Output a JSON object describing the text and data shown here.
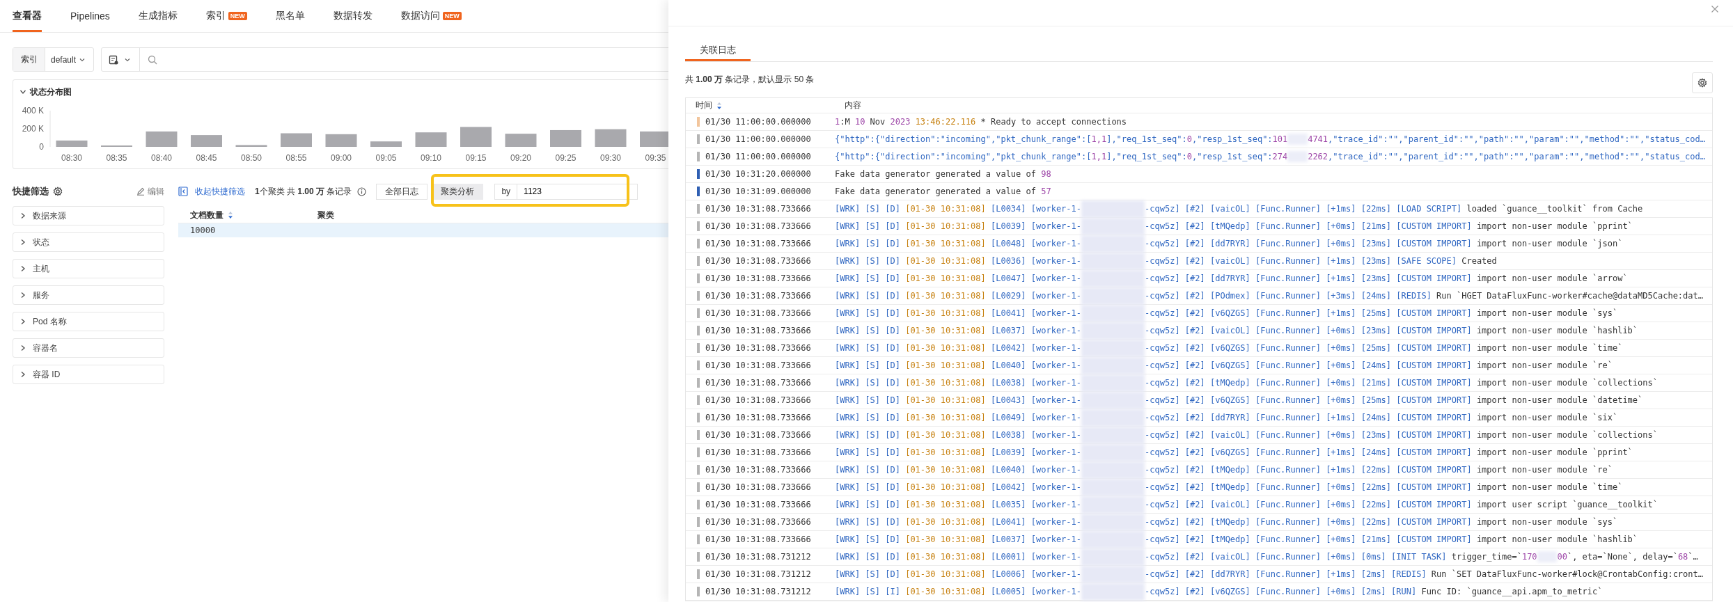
{
  "nav_tabs": [
    {
      "label": "查看器",
      "selected": true
    },
    {
      "label": "Pipelines",
      "selected": false
    },
    {
      "label": "生成指标",
      "selected": false
    },
    {
      "label": "索引",
      "badge": "NEW",
      "selected": false
    },
    {
      "label": "黑名单",
      "selected": false
    },
    {
      "label": "数据转发",
      "selected": false
    },
    {
      "label": "数据访问",
      "badge": "NEW",
      "selected": false
    }
  ],
  "query_bar": {
    "index_label": "索引",
    "index_value": "default"
  },
  "distribution_chart": {
    "title": "状态分布图",
    "expanded": true,
    "chart_data": {
      "type": "bar",
      "categories": [
        "08:30",
        "08:35",
        "08:40",
        "08:45",
        "08:50",
        "08:55",
        "09:00",
        "09:05",
        "09:10",
        "09:15",
        "09:20",
        "09:25",
        "09:30",
        "09:35"
      ],
      "values": [
        70000,
        15000,
        170000,
        130000,
        20000,
        150000,
        140000,
        60000,
        160000,
        220000,
        145000,
        185000,
        195000,
        170000
      ],
      "ylim": [
        0,
        400000
      ],
      "yticks": [
        {
          "value": 0,
          "label": "0"
        },
        {
          "value": 200000,
          "label": "200 K"
        },
        {
          "value": 400000,
          "label": "400 K"
        }
      ]
    }
  },
  "quick_filter": {
    "title": "快捷筛选",
    "edit_label": "编辑",
    "groups": [
      {
        "label": "数据来源",
        "expanded": false
      },
      {
        "label": "状态",
        "expanded": false
      },
      {
        "label": "主机",
        "expanded": false
      },
      {
        "label": "服务",
        "expanded": false
      },
      {
        "label": "Pod 名称",
        "expanded": false
      },
      {
        "label": "容器名",
        "expanded": false
      },
      {
        "label": "容器 ID",
        "expanded": false
      }
    ]
  },
  "cluster_toolbar": {
    "collapse_link": "收起快捷筛选",
    "summary": "**1**个聚类 共 **1.00 万** 条记录",
    "modes": [
      {
        "label": "全部日志",
        "selected": false
      },
      {
        "label": "聚类分析",
        "selected": true
      }
    ],
    "by_label": "by",
    "field_value": "1123",
    "highlighted": true
  },
  "cluster_table": {
    "columns": [
      {
        "label": "文档数量",
        "sortable": true
      },
      {
        "label": "聚类",
        "sortable": false
      }
    ],
    "rows": [
      {
        "count": "10000",
        "selected": true
      }
    ]
  },
  "drawer": {
    "tabs": [
      {
        "label": "关联日志",
        "selected": true
      }
    ],
    "summary": "共 **1.00 万** 条记录，默认显示 50 条",
    "columns": [
      {
        "label": "时间",
        "sortable": true
      },
      {
        "label": "内容",
        "sortable": false
      }
    ],
    "rows": [
      {
        "color": "#f2c59c",
        "time": "01/30 11:00:00.000000",
        "content": [
          {
            "kind": "num",
            "text": "1"
          },
          {
            "kind": "plain",
            "text": ":M "
          },
          {
            "kind": "num",
            "text": "10"
          },
          {
            "kind": "plain",
            "text": " Nov "
          },
          {
            "kind": "num",
            "text": "2023"
          },
          {
            "kind": "stamp",
            "text": " 13:46:22.116"
          },
          {
            "kind": "plain",
            "text": " * Ready to accept connections"
          }
        ]
      },
      {
        "color": "#b5b5b5",
        "time": "01/30 11:00:00.000000",
        "content": [
          {
            "kind": "tag",
            "text": "{\"http\":{\"direction\":\"incoming\",\"pkt_chunk_range\":["
          },
          {
            "kind": "num",
            "text": "1,1"
          },
          {
            "kind": "tag",
            "text": "],\"req_1st_seq\":"
          },
          {
            "kind": "num",
            "text": "0"
          },
          {
            "kind": "tag",
            "text": ",\"resp_1st_seq\":"
          },
          {
            "kind": "num",
            "text": "101"
          },
          {
            "kind": "blur"
          },
          {
            "kind": "num",
            "text": "4741"
          },
          {
            "kind": "tag",
            "text": ",\"trace_id\":\"\",\"parent_id\":\"\",\"path\":\"\",\"param\":\"\",\"method\":\"\",\"status_cod…"
          }
        ]
      },
      {
        "color": "#b5b5b5",
        "time": "01/30 11:00:00.000000",
        "content": [
          {
            "kind": "tag",
            "text": "{\"http\":{\"direction\":\"incoming\",\"pkt_chunk_range\":["
          },
          {
            "kind": "num",
            "text": "1,1"
          },
          {
            "kind": "tag",
            "text": "],\"req_1st_seq\":"
          },
          {
            "kind": "num",
            "text": "0"
          },
          {
            "kind": "tag",
            "text": ",\"resp_1st_seq\":"
          },
          {
            "kind": "num",
            "text": "274"
          },
          {
            "kind": "blur"
          },
          {
            "kind": "num",
            "text": "2262"
          },
          {
            "kind": "tag",
            "text": ",\"trace_id\":\"\",\"parent_id\":\"\",\"path\":\"\",\"param\":\"\",\"method\":\"\",\"status_cod…"
          }
        ]
      },
      {
        "color": "#2f5fb3",
        "time": "01/30 10:31:20.000000",
        "content": [
          {
            "kind": "plain",
            "text": "Fake data generator generated a value of "
          },
          {
            "kind": "num",
            "text": "98"
          }
        ]
      },
      {
        "color": "#2f5fb3",
        "time": "01/30 10:31:09.000000",
        "content": [
          {
            "kind": "plain",
            "text": "Fake data generator generated a value of "
          },
          {
            "kind": "num",
            "text": "57"
          }
        ]
      },
      {
        "color": "#b5b5b5",
        "time": "01/30 10:31:08.733666",
        "content": [
          {
            "kind": "tag",
            "text": "[WRK] [S] [D] "
          },
          {
            "kind": "stamp",
            "text": "[01-30 10:31:08]"
          },
          {
            "kind": "tag",
            "text": " [L0034] [worker-1-"
          },
          {
            "kind": "mask"
          },
          {
            "kind": "tag",
            "text": "-cqw5z] [#2] [vaicOL] [Func.Runner] [+1ms] [22ms] [LOAD SCRIPT]"
          },
          {
            "kind": "plain",
            "text": " loaded `guance__toolkit` from Cache"
          }
        ]
      },
      {
        "color": "#b5b5b5",
        "time": "01/30 10:31:08.733666",
        "content": [
          {
            "kind": "tag",
            "text": "[WRK] [S] [D] "
          },
          {
            "kind": "stamp",
            "text": "[01-30 10:31:08]"
          },
          {
            "kind": "tag",
            "text": " [L0039] [worker-1-"
          },
          {
            "kind": "mask"
          },
          {
            "kind": "tag",
            "text": "-cqw5z] [#2] [tMQedp] [Func.Runner] [+0ms] [21ms] [CUSTOM IMPORT]"
          },
          {
            "kind": "plain",
            "text": " import non-user module `pprint`"
          }
        ]
      },
      {
        "color": "#b5b5b5",
        "time": "01/30 10:31:08.733666",
        "content": [
          {
            "kind": "tag",
            "text": "[WRK] [S] [D] "
          },
          {
            "kind": "stamp",
            "text": "[01-30 10:31:08]"
          },
          {
            "kind": "tag",
            "text": " [L0048] [worker-1-"
          },
          {
            "kind": "mask"
          },
          {
            "kind": "tag",
            "text": "-cqw5z] [#2] [dd7RYR] [Func.Runner] [+0ms] [23ms] [CUSTOM IMPORT]"
          },
          {
            "kind": "plain",
            "text": " import non-user module `json`"
          }
        ]
      },
      {
        "color": "#b5b5b5",
        "time": "01/30 10:31:08.733666",
        "content": [
          {
            "kind": "tag",
            "text": "[WRK] [S] [D] "
          },
          {
            "kind": "stamp",
            "text": "[01-30 10:31:08]"
          },
          {
            "kind": "tag",
            "text": " [L0036] [worker-1-"
          },
          {
            "kind": "mask"
          },
          {
            "kind": "tag",
            "text": "-cqw5z] [#2] [vaicOL] [Func.Runner] [+1ms] [23ms] [SAFE SCOPE]"
          },
          {
            "kind": "plain",
            "text": " Created"
          }
        ]
      },
      {
        "color": "#b5b5b5",
        "time": "01/30 10:31:08.733666",
        "content": [
          {
            "kind": "tag",
            "text": "[WRK] [S] [D] "
          },
          {
            "kind": "stamp",
            "text": "[01-30 10:31:08]"
          },
          {
            "kind": "tag",
            "text": " [L0047] [worker-1-"
          },
          {
            "kind": "mask"
          },
          {
            "kind": "tag",
            "text": "-cqw5z] [#2] [dd7RYR] [Func.Runner] [+1ms] [23ms] [CUSTOM IMPORT]"
          },
          {
            "kind": "plain",
            "text": " import non-user module `arrow`"
          }
        ]
      },
      {
        "color": "#b5b5b5",
        "time": "01/30 10:31:08.733666",
        "content": [
          {
            "kind": "tag",
            "text": "[WRK] [S] [D] "
          },
          {
            "kind": "stamp",
            "text": "[01-30 10:31:08]"
          },
          {
            "kind": "tag",
            "text": " [L0029] [worker-1-"
          },
          {
            "kind": "mask"
          },
          {
            "kind": "tag",
            "text": "-cqw5z] [#2] [POdmex] [Func.Runner] [+3ms] [24ms] [REDIS]"
          },
          {
            "kind": "plain",
            "text": " Run `HGET DataFluxFunc-worker#cache@dataMD5Cache:dat…"
          }
        ]
      },
      {
        "color": "#b5b5b5",
        "time": "01/30 10:31:08.733666",
        "content": [
          {
            "kind": "tag",
            "text": "[WRK] [S] [D] "
          },
          {
            "kind": "stamp",
            "text": "[01-30 10:31:08]"
          },
          {
            "kind": "tag",
            "text": " [L0041] [worker-1-"
          },
          {
            "kind": "mask"
          },
          {
            "kind": "tag",
            "text": "-cqw5z] [#2] [v6QZGS] [Func.Runner] [+1ms] [25ms] [CUSTOM IMPORT]"
          },
          {
            "kind": "plain",
            "text": " import non-user module `sys`"
          }
        ]
      },
      {
        "color": "#b5b5b5",
        "time": "01/30 10:31:08.733666",
        "content": [
          {
            "kind": "tag",
            "text": "[WRK] [S] [D] "
          },
          {
            "kind": "stamp",
            "text": "[01-30 10:31:08]"
          },
          {
            "kind": "tag",
            "text": " [L0037] [worker-1-"
          },
          {
            "kind": "mask"
          },
          {
            "kind": "tag",
            "text": "-cqw5z] [#2] [vaicOL] [Func.Runner] [+0ms] [23ms] [CUSTOM IMPORT]"
          },
          {
            "kind": "plain",
            "text": " import non-user module `hashlib`"
          }
        ]
      },
      {
        "color": "#b5b5b5",
        "time": "01/30 10:31:08.733666",
        "content": [
          {
            "kind": "tag",
            "text": "[WRK] [S] [D] "
          },
          {
            "kind": "stamp",
            "text": "[01-30 10:31:08]"
          },
          {
            "kind": "tag",
            "text": " [L0042] [worker-1-"
          },
          {
            "kind": "mask"
          },
          {
            "kind": "tag",
            "text": "-cqw5z] [#2] [v6QZGS] [Func.Runner] [+0ms] [25ms] [CUSTOM IMPORT]"
          },
          {
            "kind": "plain",
            "text": " import non-user module `time`"
          }
        ]
      },
      {
        "color": "#b5b5b5",
        "time": "01/30 10:31:08.733666",
        "content": [
          {
            "kind": "tag",
            "text": "[WRK] [S] [D] "
          },
          {
            "kind": "stamp",
            "text": "[01-30 10:31:08]"
          },
          {
            "kind": "tag",
            "text": " [L0040] [worker-1-"
          },
          {
            "kind": "mask"
          },
          {
            "kind": "tag",
            "text": "-cqw5z] [#2] [v6QZGS] [Func.Runner] [+0ms] [24ms] [CUSTOM IMPORT]"
          },
          {
            "kind": "plain",
            "text": " import non-user module `re`"
          }
        ]
      },
      {
        "color": "#b5b5b5",
        "time": "01/30 10:31:08.733666",
        "content": [
          {
            "kind": "tag",
            "text": "[WRK] [S] [D] "
          },
          {
            "kind": "stamp",
            "text": "[01-30 10:31:08]"
          },
          {
            "kind": "tag",
            "text": " [L0038] [worker-1-"
          },
          {
            "kind": "mask"
          },
          {
            "kind": "tag",
            "text": "-cqw5z] [#2] [tMQedp] [Func.Runner] [+0ms] [21ms] [CUSTOM IMPORT]"
          },
          {
            "kind": "plain",
            "text": " import non-user module `collections`"
          }
        ]
      },
      {
        "color": "#b5b5b5",
        "time": "01/30 10:31:08.733666",
        "content": [
          {
            "kind": "tag",
            "text": "[WRK] [S] [D] "
          },
          {
            "kind": "stamp",
            "text": "[01-30 10:31:08]"
          },
          {
            "kind": "tag",
            "text": " [L0043] [worker-1-"
          },
          {
            "kind": "mask"
          },
          {
            "kind": "tag",
            "text": "-cqw5z] [#2] [v6QZGS] [Func.Runner] [+0ms] [25ms] [CUSTOM IMPORT]"
          },
          {
            "kind": "plain",
            "text": " import non-user module `datetime`"
          }
        ]
      },
      {
        "color": "#b5b5b5",
        "time": "01/30 10:31:08.733666",
        "content": [
          {
            "kind": "tag",
            "text": "[WRK] [S] [D] "
          },
          {
            "kind": "stamp",
            "text": "[01-30 10:31:08]"
          },
          {
            "kind": "tag",
            "text": " [L0049] [worker-1-"
          },
          {
            "kind": "mask"
          },
          {
            "kind": "tag",
            "text": "-cqw5z] [#2] [dd7RYR] [Func.Runner] [+1ms] [24ms] [CUSTOM IMPORT]"
          },
          {
            "kind": "plain",
            "text": " import non-user module `six`"
          }
        ]
      },
      {
        "color": "#b5b5b5",
        "time": "01/30 10:31:08.733666",
        "content": [
          {
            "kind": "tag",
            "text": "[WRK] [S] [D] "
          },
          {
            "kind": "stamp",
            "text": "[01-30 10:31:08]"
          },
          {
            "kind": "tag",
            "text": " [L0038] [worker-1-"
          },
          {
            "kind": "mask"
          },
          {
            "kind": "tag",
            "text": "-cqw5z] [#2] [vaicOL] [Func.Runner] [+0ms] [23ms] [CUSTOM IMPORT]"
          },
          {
            "kind": "plain",
            "text": " import non-user module `collections`"
          }
        ]
      },
      {
        "color": "#b5b5b5",
        "time": "01/30 10:31:08.733666",
        "content": [
          {
            "kind": "tag",
            "text": "[WRK] [S] [D] "
          },
          {
            "kind": "stamp",
            "text": "[01-30 10:31:08]"
          },
          {
            "kind": "tag",
            "text": " [L0039] [worker-1-"
          },
          {
            "kind": "mask"
          },
          {
            "kind": "tag",
            "text": "-cqw5z] [#2] [v6QZGS] [Func.Runner] [+1ms] [24ms] [CUSTOM IMPORT]"
          },
          {
            "kind": "plain",
            "text": " import non-user module `pprint`"
          }
        ]
      },
      {
        "color": "#b5b5b5",
        "time": "01/30 10:31:08.733666",
        "content": [
          {
            "kind": "tag",
            "text": "[WRK] [S] [D] "
          },
          {
            "kind": "stamp",
            "text": "[01-30 10:31:08]"
          },
          {
            "kind": "tag",
            "text": " [L0040] [worker-1-"
          },
          {
            "kind": "mask"
          },
          {
            "kind": "tag",
            "text": "-cqw5z] [#2] [tMQedp] [Func.Runner] [+1ms] [22ms] [CUSTOM IMPORT]"
          },
          {
            "kind": "plain",
            "text": " import non-user module `re`"
          }
        ]
      },
      {
        "color": "#b5b5b5",
        "time": "01/30 10:31:08.733666",
        "content": [
          {
            "kind": "tag",
            "text": "[WRK] [S] [D] "
          },
          {
            "kind": "stamp",
            "text": "[01-30 10:31:08]"
          },
          {
            "kind": "tag",
            "text": " [L0042] [worker-1-"
          },
          {
            "kind": "mask"
          },
          {
            "kind": "tag",
            "text": "-cqw5z] [#2] [tMQedp] [Func.Runner] [+0ms] [22ms] [CUSTOM IMPORT]"
          },
          {
            "kind": "plain",
            "text": " import non-user module `time`"
          }
        ]
      },
      {
        "color": "#b5b5b5",
        "time": "01/30 10:31:08.733666",
        "content": [
          {
            "kind": "tag",
            "text": "[WRK] [S] [D] "
          },
          {
            "kind": "stamp",
            "text": "[01-30 10:31:08]"
          },
          {
            "kind": "tag",
            "text": " [L0035] [worker-1-"
          },
          {
            "kind": "mask"
          },
          {
            "kind": "tag",
            "text": "-cqw5z] [#2] [vaicOL] [Func.Runner] [+0ms] [22ms] [CUSTOM IMPORT]"
          },
          {
            "kind": "plain",
            "text": " import user script `guance__toolkit`"
          }
        ]
      },
      {
        "color": "#b5b5b5",
        "time": "01/30 10:31:08.733666",
        "content": [
          {
            "kind": "tag",
            "text": "[WRK] [S] [D] "
          },
          {
            "kind": "stamp",
            "text": "[01-30 10:31:08]"
          },
          {
            "kind": "tag",
            "text": " [L0041] [worker-1-"
          },
          {
            "kind": "mask"
          },
          {
            "kind": "tag",
            "text": "-cqw5z] [#2] [tMQedp] [Func.Runner] [+0ms] [22ms] [CUSTOM IMPORT]"
          },
          {
            "kind": "plain",
            "text": " import non-user module `sys`"
          }
        ]
      },
      {
        "color": "#b5b5b5",
        "time": "01/30 10:31:08.733666",
        "content": [
          {
            "kind": "tag",
            "text": "[WRK] [S] [D] "
          },
          {
            "kind": "stamp",
            "text": "[01-30 10:31:08]"
          },
          {
            "kind": "tag",
            "text": " [L0037] [worker-1-"
          },
          {
            "kind": "mask"
          },
          {
            "kind": "tag",
            "text": "-cqw5z] [#2] [tMQedp] [Func.Runner] [+0ms] [21ms] [CUSTOM IMPORT]"
          },
          {
            "kind": "plain",
            "text": " import non-user module `hashlib`"
          }
        ]
      },
      {
        "color": "#b5b5b5",
        "time": "01/30 10:31:08.731212",
        "content": [
          {
            "kind": "tag",
            "text": "[WRK] [S] [D] "
          },
          {
            "kind": "stamp",
            "text": "[01-30 10:31:08]"
          },
          {
            "kind": "tag",
            "text": " [L0001] [worker-1-"
          },
          {
            "kind": "mask"
          },
          {
            "kind": "tag",
            "text": "-cqw5z] [#2] [vaicOL] [Func.Runner] [+0ms] [0ms] [INIT TASK]"
          },
          {
            "kind": "plain",
            "text": " trigger_time=`"
          },
          {
            "kind": "num",
            "text": "170"
          },
          {
            "kind": "blur"
          },
          {
            "kind": "num",
            "text": "00"
          },
          {
            "kind": "plain",
            "text": "`, eta=`None`, delay=`"
          },
          {
            "kind": "num",
            "text": "68"
          },
          {
            "kind": "plain",
            "text": "`…"
          }
        ]
      },
      {
        "color": "#b5b5b5",
        "time": "01/30 10:31:08.731212",
        "content": [
          {
            "kind": "tag",
            "text": "[WRK] [S] [D] "
          },
          {
            "kind": "stamp",
            "text": "[01-30 10:31:08]"
          },
          {
            "kind": "tag",
            "text": " [L0006] [worker-1-"
          },
          {
            "kind": "mask"
          },
          {
            "kind": "tag",
            "text": "-cqw5z] [#2] [dd7RYR] [Func.Runner] [+1ms] [2ms] [REDIS]"
          },
          {
            "kind": "plain",
            "text": " Run `SET DataFluxFunc-worker#lock@CrontabConfig:cront…"
          }
        ]
      },
      {
        "color": "#b5b5b5",
        "time": "01/30 10:31:08.731212",
        "content": [
          {
            "kind": "tag",
            "text": "[WRK] [S] [I] "
          },
          {
            "kind": "stamp",
            "text": "[01-30 10:31:08]"
          },
          {
            "kind": "tag",
            "text": " [L0005] [worker-1-"
          },
          {
            "kind": "mask"
          },
          {
            "kind": "tag",
            "text": "-cqw5z] [#2] [v6QZGS] [Func.Runner] [+0ms] [2ms] [RUN]"
          },
          {
            "kind": "plain",
            "text": " Func ID: `guance__api.apm_to_metric`"
          }
        ]
      }
    ]
  }
}
